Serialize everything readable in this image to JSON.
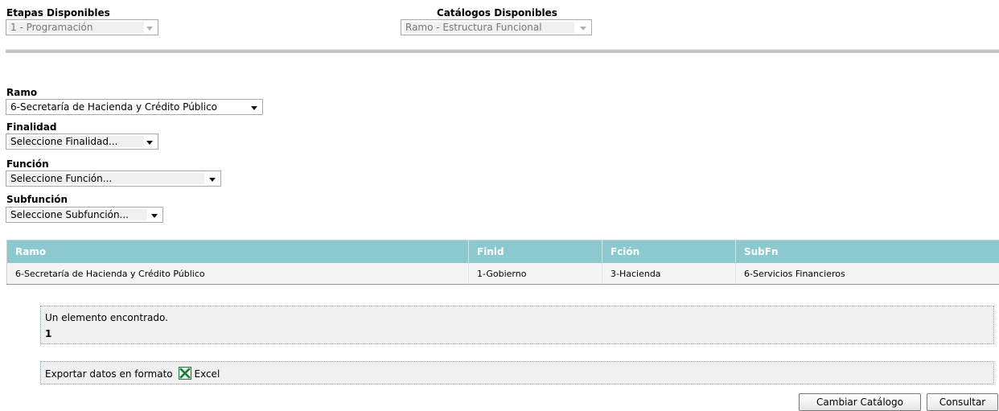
{
  "header": {
    "etapas_label": "Etapas Disponibles",
    "etapas_value": "1 - Programación",
    "catalogos_label": "Catálogos Disponibles",
    "catalogos_value": "Ramo - Estructura Funcional"
  },
  "filters": {
    "ramo_label": "Ramo",
    "ramo_value": "6-Secretaría de Hacienda y Crédito Público",
    "finalidad_label": "Finalidad",
    "finalidad_value": "Seleccione Finalidad...",
    "funcion_label": "Función",
    "funcion_value": "Seleccione Función...",
    "subfuncion_label": "Subfunción",
    "subfuncion_value": "Seleccione Subfunción..."
  },
  "table": {
    "headers": [
      "Ramo",
      "Finld",
      "Fción",
      "SubFn"
    ],
    "rows": [
      [
        "6-Secretaría de Hacienda y Crédito Público",
        "1-Gobierno",
        "3-Hacienda",
        "6-Servicios Financieros"
      ]
    ]
  },
  "results": {
    "found_text": "Un elemento encontrado.",
    "page_number": "1"
  },
  "export": {
    "prefix": "Exportar datos en formato",
    "link_label": "Excel",
    "icon": "excel-icon"
  },
  "buttons": {
    "change_catalog": "Cambiar Catálogo",
    "query": "Consultar"
  },
  "colors": {
    "table_header_bg": "#8bc9cf",
    "table_row_bg": "#f4f4f4",
    "excel_green": "#1d7a3a"
  }
}
